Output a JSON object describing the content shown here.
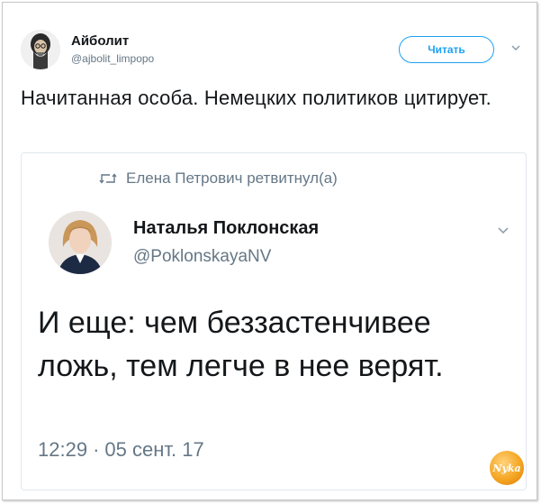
{
  "tweet": {
    "author": {
      "name": "Айболит",
      "handle": "@ajbolit_limpopo"
    },
    "follow_label": "Читать",
    "text": "Начитанная особа. Немецких политиков цитирует."
  },
  "quoted_tweet": {
    "retweeted_by": "Елена Петрович ретвитнул(а)",
    "author": {
      "name": "Наталья Поклонская",
      "handle": "@PoklonskayaNV"
    },
    "text": "И еще: чем беззастенчивее ложь, тем легче в нее верят.",
    "time": "12:29",
    "separator": "·",
    "date": "05 сент. 17"
  },
  "watermark": {
    "text": "Nyka"
  },
  "colors": {
    "accent": "#1da1f2",
    "secondary_text": "#657786",
    "primary_text": "#14171a",
    "border": "#e1e8ed"
  },
  "icons": {
    "retweet": "retweet-icon",
    "caret": "chevron-down-icon"
  }
}
